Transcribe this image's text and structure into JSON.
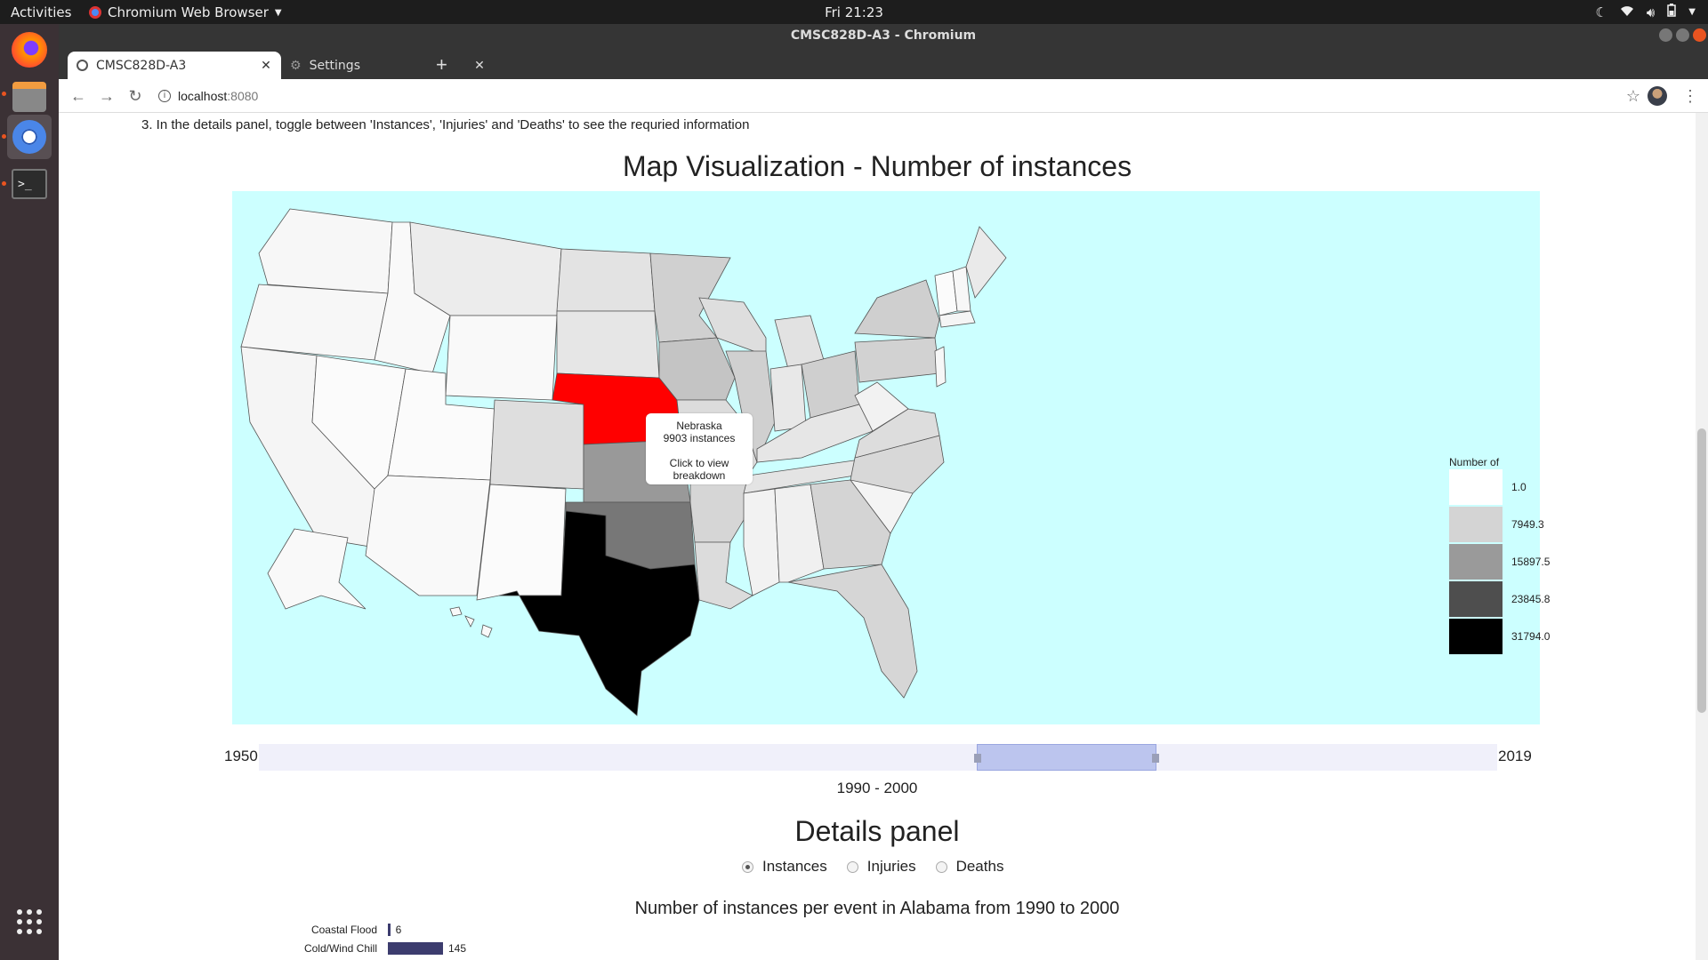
{
  "system": {
    "activities": "Activities",
    "app_menu": "Chromium Web Browser",
    "clock": "Fri 21:23"
  },
  "window": {
    "title": "CMSC828D-A3 - Chromium"
  },
  "tabs": [
    {
      "label": "CMSC828D-A3"
    },
    {
      "label": "Settings"
    }
  ],
  "address": {
    "host": "localhost",
    "port": ":8080"
  },
  "page": {
    "instruction": "3. In the details panel, toggle between 'Instances', 'Injuries' and 'Deaths' to see the requried information",
    "map_title": "Map Visualization - Number of instances",
    "legend": {
      "title": "Number of instances",
      "items": [
        {
          "label": "1.0",
          "color": "#ffffff"
        },
        {
          "label": "7949.3",
          "color": "#d4d4d4"
        },
        {
          "label": "15897.5",
          "color": "#9a9a9a"
        },
        {
          "label": "23845.8",
          "color": "#4e4e4e"
        },
        {
          "label": "31794.0",
          "color": "#000000"
        }
      ]
    },
    "tooltip": {
      "state": "Nebraska",
      "count": "9903 instances",
      "hint": "Click to view breakdown"
    },
    "slider": {
      "min_label": "1950",
      "max_label": "2019",
      "range_label": "1990 - 2000",
      "min": 1950,
      "max": 2019,
      "start": 1990,
      "end": 2000
    },
    "details_title": "Details panel",
    "radios": [
      {
        "label": "Instances",
        "checked": true
      },
      {
        "label": "Injuries",
        "checked": false
      },
      {
        "label": "Deaths",
        "checked": false
      }
    ],
    "bar_title": "Number of instances per event in Alabama from 1990 to 2000",
    "bars": [
      {
        "category": "Coastal Flood",
        "value": 6
      },
      {
        "category": "Cold/Wind Chill",
        "value": 145
      }
    ],
    "colors": {
      "ocean": "#ccffff",
      "highlight": "#ff0000",
      "bar": "#3c3c6e",
      "slider_range": "#bcc5ee"
    }
  }
}
